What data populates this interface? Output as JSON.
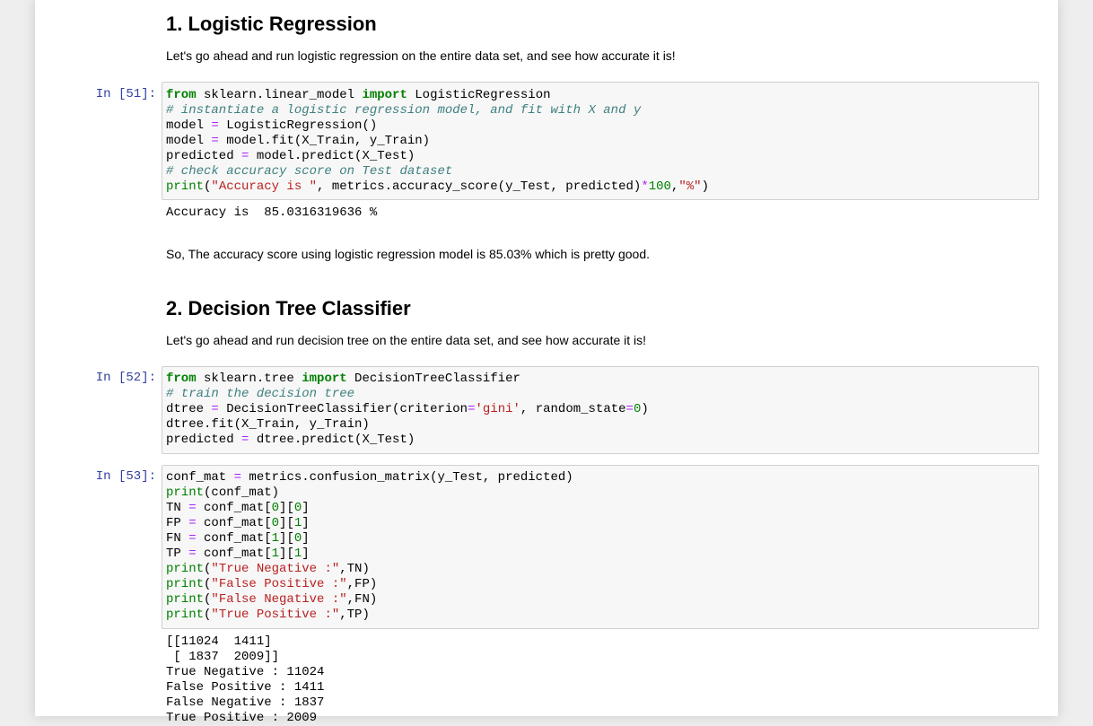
{
  "section1": {
    "heading": "1. Logistic Regression",
    "intro": "Let's go ahead and run logistic regression on the entire data set, and see how accurate it is!",
    "cell": {
      "prompt": "In [51]:",
      "lines": {
        "l1": {
          "a": "from",
          "b": " sklearn.linear_model ",
          "c": "import",
          "d": " LogisticRegression"
        },
        "l2": "# instantiate a logistic regression model, and fit with X and y",
        "l3": {
          "a": "model ",
          "b": "=",
          "c": " LogisticRegression()"
        },
        "l4": {
          "a": "model ",
          "b": "=",
          "c": " model.fit(X_Train, y_Train)"
        },
        "l5": {
          "a": "predicted ",
          "b": "=",
          "c": " model.predict(X_Test)"
        },
        "l6": "# check accuracy score on Test dataset",
        "l7": {
          "a": "print",
          "b": "(",
          "c": "\"Accuracy is \"",
          "d": ", metrics.accuracy_score(y_Test, predicted)",
          "e": "*",
          "f": "100",
          "g": ",",
          "h": "\"%\"",
          "i": ")"
        }
      },
      "output": "Accuracy is  85.0316319636 %"
    },
    "conclusion": "So, The accuracy score using logistic regression model is 85.03% which is pretty good."
  },
  "section2": {
    "heading": "2. Decision Tree Classifier",
    "intro": "Let's go ahead and run decision tree on the entire data set, and see how accurate it is!",
    "cell": {
      "prompt": "In [52]:",
      "lines": {
        "l1": {
          "a": "from",
          "b": " sklearn.tree ",
          "c": "import",
          "d": " DecisionTreeClassifier"
        },
        "l2": "# train the decision tree",
        "l3": {
          "a": "dtree ",
          "b": "=",
          "c": " DecisionTreeClassifier(criterion",
          "d": "=",
          "e": "'gini'",
          "f": ", random_state",
          "g": "=",
          "h": "0",
          "i": ")"
        },
        "l4": "dtree.fit(X_Train, y_Train)",
        "l5": {
          "a": "predicted ",
          "b": "=",
          "c": " dtree.predict(X_Test)"
        }
      }
    }
  },
  "cell53": {
    "prompt": "In [53]:",
    "lines": {
      "l1": {
        "a": "conf_mat ",
        "b": "=",
        "c": " metrics.confusion_matrix(y_Test, predicted)"
      },
      "l2": {
        "a": "print",
        "b": "(conf_mat)"
      },
      "l3": {
        "a": "TN ",
        "b": "=",
        "c": " conf_mat[",
        "d": "0",
        "e": "][",
        "f": "0",
        "g": "]"
      },
      "l4": {
        "a": "FP ",
        "b": "=",
        "c": " conf_mat[",
        "d": "0",
        "e": "][",
        "f": "1",
        "g": "]"
      },
      "l5": {
        "a": "FN ",
        "b": "=",
        "c": " conf_mat[",
        "d": "1",
        "e": "][",
        "f": "0",
        "g": "]"
      },
      "l6": {
        "a": "TP ",
        "b": "=",
        "c": " conf_mat[",
        "d": "1",
        "e": "][",
        "f": "1",
        "g": "]"
      },
      "l7": {
        "a": "print",
        "b": "(",
        "c": "\"True Negative :\"",
        "d": ",TN)"
      },
      "l8": {
        "a": "print",
        "b": "(",
        "c": "\"False Positive :\"",
        "d": ",FP)"
      },
      "l9": {
        "a": "print",
        "b": "(",
        "c": "\"False Negative :\"",
        "d": ",FN)"
      },
      "l10": {
        "a": "print",
        "b": "(",
        "c": "\"True Positive :\"",
        "d": ",TP)"
      }
    },
    "output": {
      "o1": "[[11024  1411]",
      "o2": " [ 1837  2009]]",
      "o3": "True Negative : 11024",
      "o4": "False Positive : 1411",
      "o5": "False Negative : 1837",
      "o6": "True Positive : 2009"
    }
  }
}
